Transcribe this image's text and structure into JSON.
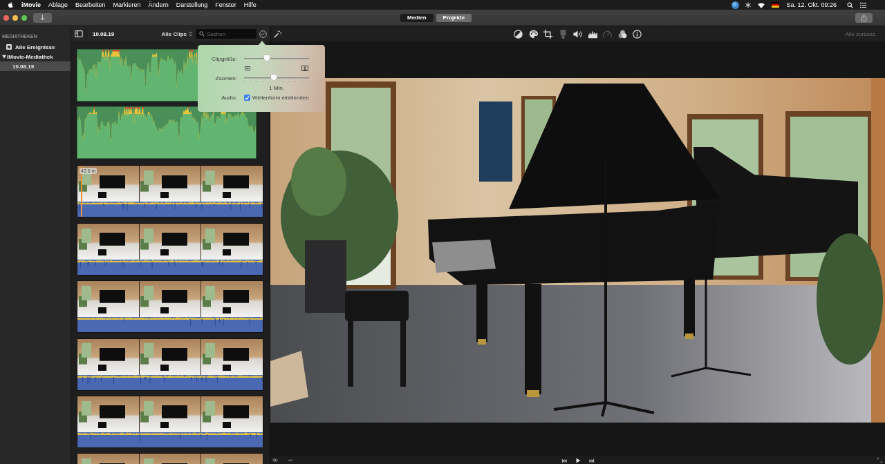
{
  "menu_bar": {
    "app": "iMovie",
    "menus": [
      "Ablage",
      "Bearbeiten",
      "Markieren",
      "Ändern",
      "Darstellung",
      "Fenster",
      "Hilfe"
    ],
    "clock": "Sa. 12. Okt. 09:26"
  },
  "toolbar": {
    "tabs": [
      {
        "label": "Medien",
        "selected": true
      },
      {
        "label": "Projekte",
        "selected": false
      }
    ]
  },
  "sidebar": {
    "header": "MEDIATHEKEN",
    "items": [
      {
        "label": "Alle Ereignisse",
        "kind": "all-events",
        "selected": false
      },
      {
        "label": "iMovie-Mediathek",
        "kind": "library",
        "selected": false,
        "expanded": true,
        "children": [
          {
            "label": "10.08.19",
            "selected": true
          }
        ]
      }
    ]
  },
  "browser": {
    "event_title": "10.08.19",
    "filter": "Alle Clips",
    "search": {
      "placeholder": "Suchen"
    },
    "clips": [
      {
        "kind": "audio"
      },
      {
        "kind": "audio"
      },
      {
        "kind": "video",
        "skimmer_time": "42,6 m"
      },
      {
        "kind": "video"
      },
      {
        "kind": "video"
      },
      {
        "kind": "video"
      },
      {
        "kind": "video"
      },
      {
        "kind": "video"
      }
    ]
  },
  "view_options": {
    "clip_size": {
      "label": "Clipgröße:",
      "level": 0.35
    },
    "zoom": {
      "label": "Zoomen:",
      "level": 0.46,
      "reading": "1 Min."
    },
    "audio": {
      "label": "Audio:",
      "option": "Wellenform einblenden",
      "checked": true
    }
  },
  "viewer": {
    "tools": [
      {
        "kind": "color-balance",
        "disabled": false
      },
      {
        "kind": "color-correction",
        "disabled": false
      },
      {
        "kind": "crop",
        "disabled": false
      },
      {
        "kind": "stabilization",
        "disabled": true
      },
      {
        "kind": "volume",
        "disabled": false
      },
      {
        "kind": "noise-reduction",
        "disabled": false
      },
      {
        "kind": "speed",
        "disabled": true
      },
      {
        "kind": "filter",
        "disabled": false
      },
      {
        "kind": "info",
        "disabled": false
      }
    ],
    "reset_all": {
      "label": "Alle zurücks.",
      "disabled": true
    }
  }
}
